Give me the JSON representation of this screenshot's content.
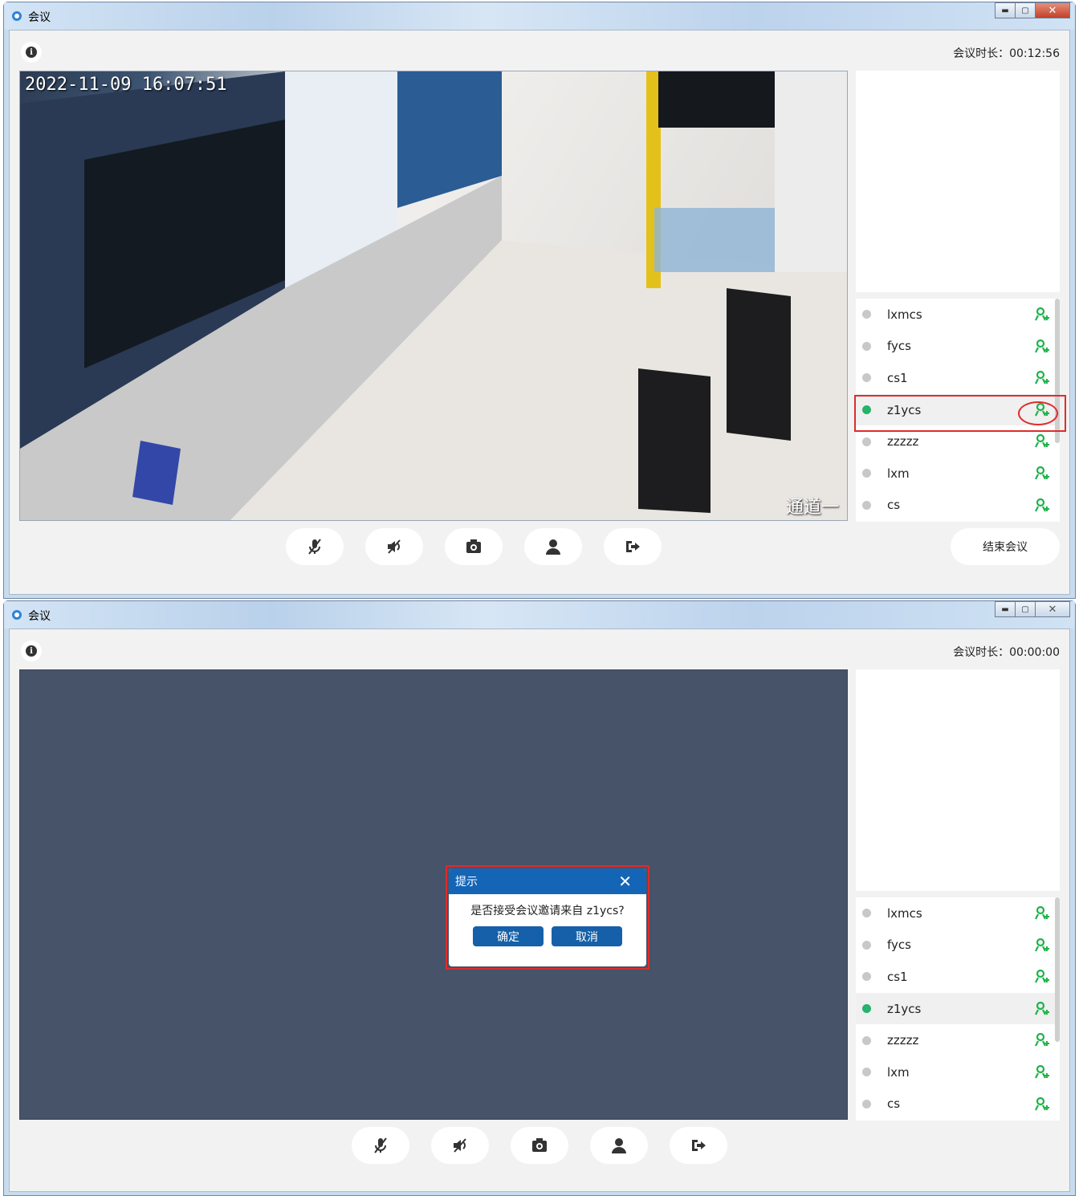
{
  "window1": {
    "title": "会议",
    "duration": "会议时长：00:12:56",
    "video": {
      "timestamp": "2022-11-09 16:07:51",
      "channel": "通道一"
    },
    "participants": [
      {
        "name": "lxmcs",
        "online": false
      },
      {
        "name": "fycs",
        "online": false
      },
      {
        "name": "cs1",
        "online": false
      },
      {
        "name": "z1ycs",
        "online": true
      },
      {
        "name": "zzzzz",
        "online": false
      },
      {
        "name": "lxm",
        "online": false
      },
      {
        "name": "cs",
        "online": false
      }
    ],
    "end_button": "结束会议"
  },
  "window2": {
    "title": "会议",
    "duration": "会议时长：00:00:00",
    "participants": [
      {
        "name": "lxmcs",
        "online": false
      },
      {
        "name": "fycs",
        "online": false
      },
      {
        "name": "cs1",
        "online": false
      },
      {
        "name": "z1ycs",
        "online": true
      },
      {
        "name": "zzzzz",
        "online": false
      },
      {
        "name": "lxm",
        "online": false
      },
      {
        "name": "cs",
        "online": false
      }
    ],
    "dialog": {
      "title": "提示",
      "message": "是否接受会议邀请来自 z1ycs?",
      "confirm": "确定",
      "cancel": "取消"
    }
  },
  "icons": {
    "info": "info-icon",
    "mic": "mic-off-icon",
    "speaker": "speaker-mute-icon",
    "camera": "camera-icon",
    "user": "user-icon",
    "exit": "exit-icon",
    "participant": "add-user-icon"
  },
  "colors": {
    "online": "#26b36b",
    "offline": "#c8c8c8",
    "highlight": "#e02b2b",
    "dialog_header": "#1565b6",
    "user_icon": "#1db34a"
  }
}
